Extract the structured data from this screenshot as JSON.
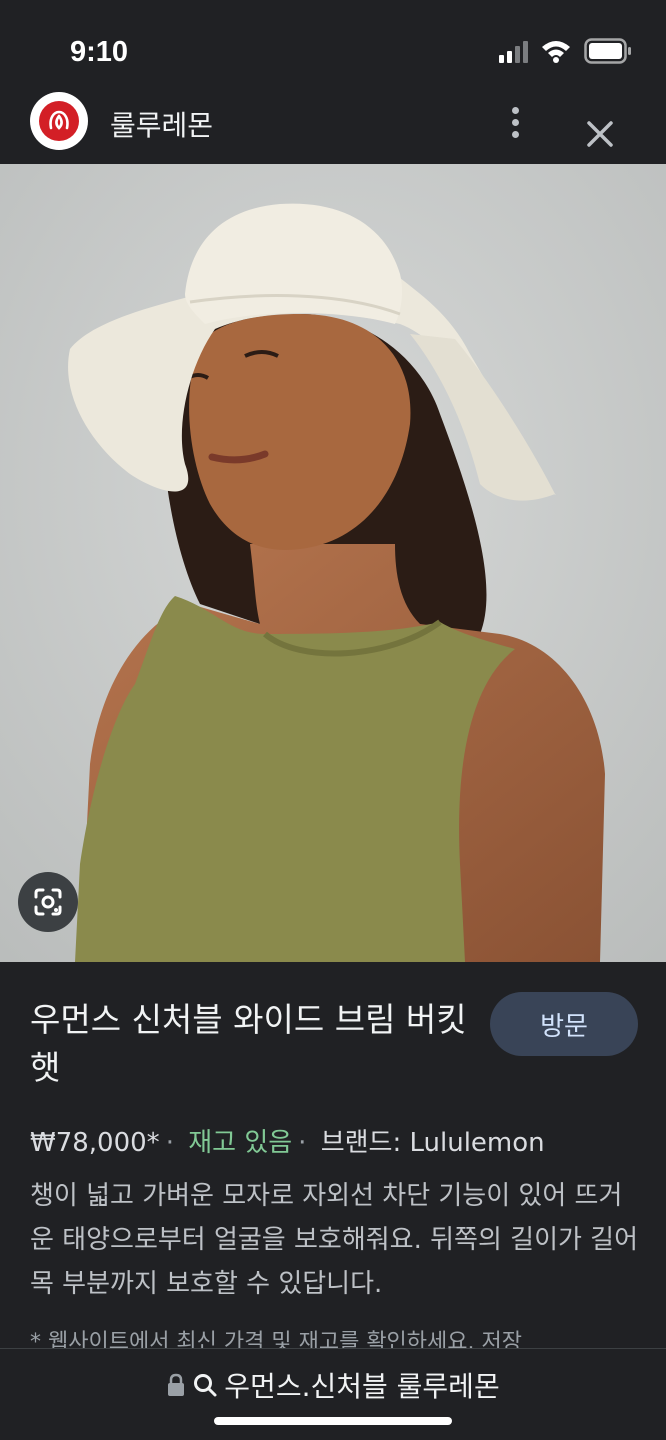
{
  "status_bar": {
    "time": "9:10",
    "icons": [
      "cellular-signal-icon",
      "wifi-icon",
      "battery-icon"
    ]
  },
  "header": {
    "logo_icon": "lululemon-logo-icon",
    "site_name": "룰루레몬",
    "more_icon": "more-vertical-icon",
    "close_icon": "close-icon"
  },
  "hero": {
    "lens_icon": "google-lens-icon"
  },
  "product": {
    "title": "우먼스 신처블 와이드 브림 버킷 햇",
    "visit_label": "방문",
    "price": "₩78,000*",
    "separator": "·",
    "stock": "재고 있음",
    "brand": "브랜드: Lululemon",
    "description": "챙이 넓고 가벼운 모자로 자외선 차단 기능이 있어 뜨거운 태양으로부터 얼굴을 보호해줘요. 뒤쪽의 길이가 길어 목 부분까지 보호할 수 있답니다.",
    "note": "* 웹사이트에서 최신 가격 및 재고를 확인하세요. 저장"
  },
  "bottom_bar": {
    "lock_icon": "lock-icon",
    "search_icon": "search-icon",
    "query": "우먼스.신처블 룰루레몬"
  },
  "colors": {
    "background": "#202124",
    "stock_green": "#81c995",
    "visit_button": "#394457",
    "brand_red": "#d31f26",
    "shirt_olive": "#8a8a4c",
    "hat_cream": "#ece8dc"
  }
}
